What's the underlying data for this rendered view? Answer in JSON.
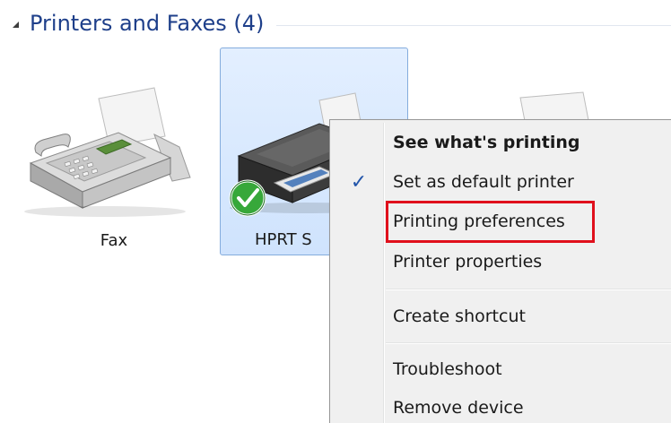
{
  "group": {
    "title": "Printers and Faxes (4)"
  },
  "devices": [
    {
      "label": "Fax",
      "icon": "fax-icon"
    },
    {
      "label": "HPRT S",
      "icon": "printer-icon",
      "badge": "default-checkmark-icon"
    },
    {
      "label": "",
      "icon": "printer-icon"
    }
  ],
  "context_menu": {
    "items": [
      {
        "label": "See what's printing",
        "bold": true
      },
      {
        "label": "Set as default printer",
        "checked": true
      },
      {
        "label": "Printing preferences",
        "highlighted": true
      },
      {
        "label": "Printer properties"
      },
      {
        "label": "Create shortcut"
      },
      {
        "label": "Troubleshoot"
      },
      {
        "label": "Remove device"
      }
    ],
    "check_glyph": "✓"
  },
  "colors": {
    "group_title": "#1e3f8a",
    "selection_fill": "#cfe3fd",
    "selection_border": "#84acdd",
    "highlight_border": "#e0101c",
    "menu_background": "#f0f0f0",
    "check_color": "#2255aa"
  }
}
